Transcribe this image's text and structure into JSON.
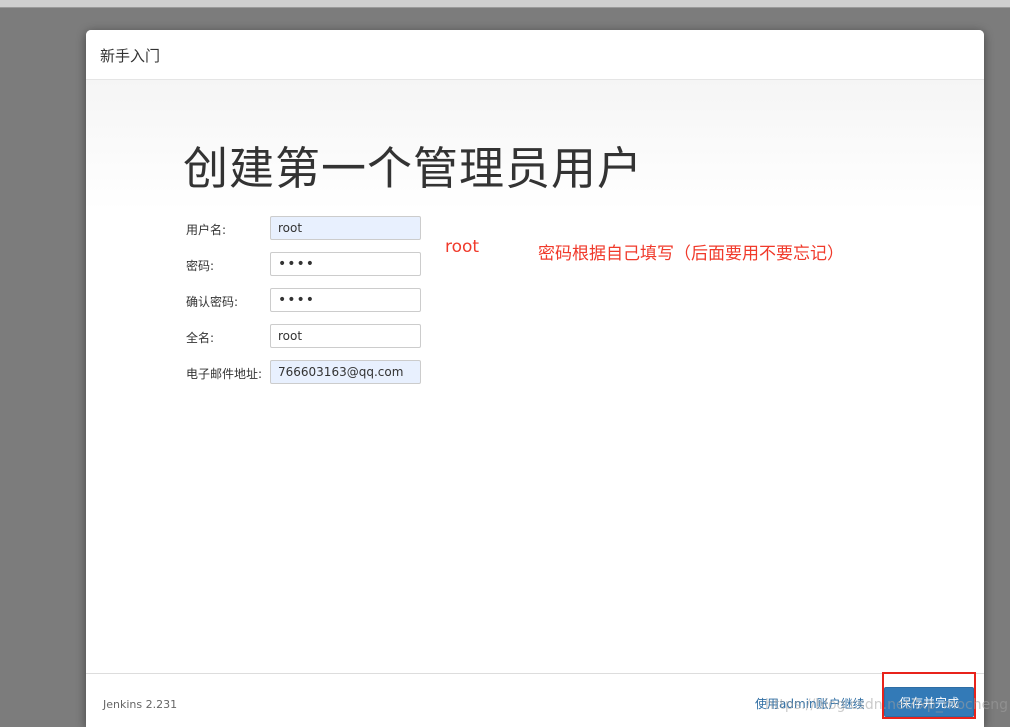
{
  "dialog": {
    "title": "新手入门",
    "heading": "创建第一个管理员用户"
  },
  "form": {
    "fields": [
      {
        "label": "用户名:",
        "value": "root",
        "type": "text"
      },
      {
        "label": "密码:",
        "value": "••••",
        "type": "password"
      },
      {
        "label": "确认密码:",
        "value": "••••",
        "type": "password"
      },
      {
        "label": "全名:",
        "value": "root",
        "type": "text"
      },
      {
        "label": "电子邮件地址:",
        "value": "766603163@qq.com",
        "type": "text"
      }
    ]
  },
  "annotations": {
    "root_note": "root",
    "password_note": "密码根据自己填写（后面要用不要忘记）",
    "color": "#f03a2b"
  },
  "footer": {
    "version": "Jenkins 2.231",
    "admin_link": "使用admin账户继续",
    "save_button": "保存并完成"
  },
  "watermark": "https://blog.csdn.net/lxp_mocheng"
}
